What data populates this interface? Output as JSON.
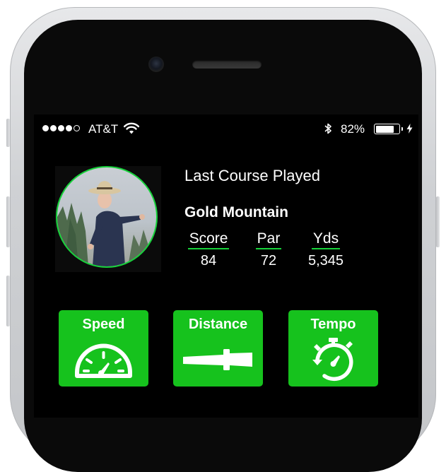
{
  "status_bar": {
    "carrier": "AT&T",
    "battery_percent_label": "82%",
    "battery_level": 0.82
  },
  "profile": {
    "last_course_label": "Last Course Played",
    "course_name": "Gold Mountain",
    "stats": [
      {
        "label": "Score",
        "value": "84"
      },
      {
        "label": "Par",
        "value": "72"
      },
      {
        "label": "Yds",
        "value": "5,345"
      }
    ]
  },
  "tiles": [
    {
      "label": "Speed",
      "icon": "speedometer-icon"
    },
    {
      "label": "Distance",
      "icon": "golf-club-icon"
    },
    {
      "label": "Tempo",
      "icon": "stopwatch-icon"
    }
  ],
  "colors": {
    "accent": "#16c21d",
    "avatar_ring": "#16d23a",
    "screen_bg": "#000000"
  }
}
